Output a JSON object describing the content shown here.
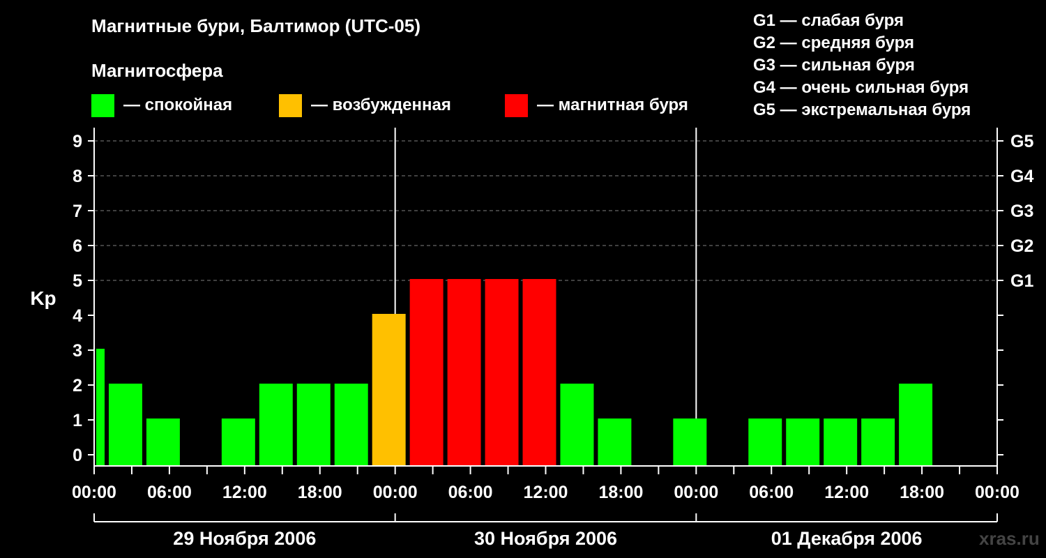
{
  "title": "Магнитные бури, Балтимор (UTC-05)",
  "magnetosphere_title": "Магнитосфера",
  "legend": [
    {
      "label": "— спокойная",
      "color": "#00ff00"
    },
    {
      "label": "— возбужденная",
      "color": "#ffc000"
    },
    {
      "label": "— магнитная буря",
      "color": "#ff0000"
    }
  ],
  "storm_scale": [
    "G1 — слабая буря",
    "G2 — средняя буря",
    "G3 — сильная буря",
    "G4 — очень сильная буря",
    "G5 — экстремальная буря"
  ],
  "watermark": "xras.ru",
  "colors": {
    "quiet": "#00ff00",
    "active": "#ffc000",
    "storm": "#ff0000",
    "background": "#000000",
    "grid": "#808080"
  },
  "chart_data": {
    "type": "bar",
    "ylabel": "Kp",
    "ylim": [
      0,
      9
    ],
    "yticks": [
      "0",
      "1",
      "2",
      "3",
      "4",
      "5",
      "6",
      "7",
      "8",
      "9"
    ],
    "right_ticks": [
      {
        "kp": 5,
        "label": "G1"
      },
      {
        "kp": 6,
        "label": "G2"
      },
      {
        "kp": 7,
        "label": "G3"
      },
      {
        "kp": 8,
        "label": "G4"
      },
      {
        "kp": 9,
        "label": "G5"
      }
    ],
    "grid": "dashed horizontal at Kp 5-9",
    "xrange_hours": [
      0,
      72
    ],
    "xtick_labels": [
      "00:00",
      "06:00",
      "12:00",
      "18:00",
      "00:00",
      "06:00",
      "12:00",
      "18:00",
      "00:00",
      "06:00",
      "12:00",
      "18:00",
      "00:00"
    ],
    "days": [
      "29 Ноября 2006",
      "30 Ноября 2006",
      "01 Декабря 2006"
    ],
    "bars": [
      {
        "start": 0,
        "end": 1,
        "kp": 3,
        "level": "quiet"
      },
      {
        "start": 1,
        "end": 4,
        "kp": 2,
        "level": "quiet"
      },
      {
        "start": 4,
        "end": 7,
        "kp": 1,
        "level": "quiet"
      },
      {
        "start": 7,
        "end": 10,
        "kp": 0,
        "level": "quiet"
      },
      {
        "start": 10,
        "end": 13,
        "kp": 1,
        "level": "quiet"
      },
      {
        "start": 13,
        "end": 16,
        "kp": 2,
        "level": "quiet"
      },
      {
        "start": 16,
        "end": 19,
        "kp": 2,
        "level": "quiet"
      },
      {
        "start": 19,
        "end": 22,
        "kp": 2,
        "level": "quiet"
      },
      {
        "start": 22,
        "end": 25,
        "kp": 4,
        "level": "active"
      },
      {
        "start": 25,
        "end": 28,
        "kp": 5,
        "level": "storm"
      },
      {
        "start": 28,
        "end": 31,
        "kp": 5,
        "level": "storm"
      },
      {
        "start": 31,
        "end": 34,
        "kp": 5,
        "level": "storm"
      },
      {
        "start": 34,
        "end": 37,
        "kp": 5,
        "level": "storm"
      },
      {
        "start": 37,
        "end": 40,
        "kp": 2,
        "level": "quiet"
      },
      {
        "start": 40,
        "end": 43,
        "kp": 1,
        "level": "quiet"
      },
      {
        "start": 43,
        "end": 46,
        "kp": 0,
        "level": "quiet"
      },
      {
        "start": 46,
        "end": 49,
        "kp": 1,
        "level": "quiet"
      },
      {
        "start": 49,
        "end": 52,
        "kp": 0,
        "level": "quiet"
      },
      {
        "start": 52,
        "end": 55,
        "kp": 1,
        "level": "quiet"
      },
      {
        "start": 55,
        "end": 58,
        "kp": 1,
        "level": "quiet"
      },
      {
        "start": 58,
        "end": 61,
        "kp": 1,
        "level": "quiet"
      },
      {
        "start": 61,
        "end": 64,
        "kp": 1,
        "level": "quiet"
      },
      {
        "start": 64,
        "end": 67,
        "kp": 2,
        "level": "quiet"
      }
    ]
  }
}
